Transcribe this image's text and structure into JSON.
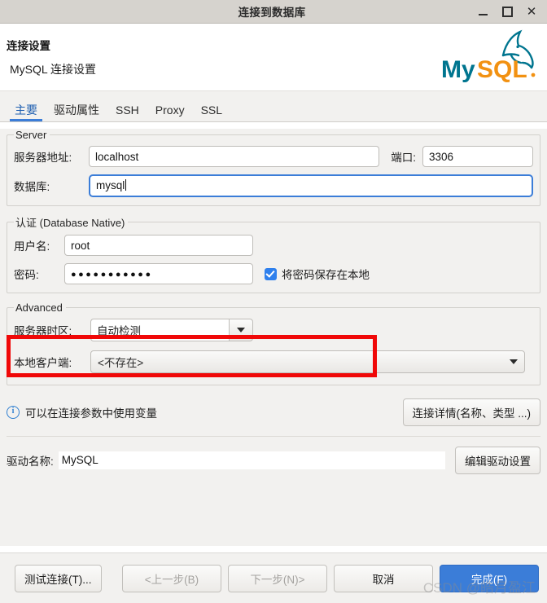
{
  "window": {
    "title": "连接到数据库",
    "minimize_label": "−",
    "maximize_label": "□",
    "close_label": "✕"
  },
  "header": {
    "title": "连接设置",
    "subtitle": "MySQL 连接设置",
    "logo_my": "My",
    "logo_sql": "SQL",
    "logo_reg": "®"
  },
  "tabs": [
    {
      "label": "主要",
      "active": true
    },
    {
      "label": "驱动属性",
      "active": false
    },
    {
      "label": "SSH",
      "active": false
    },
    {
      "label": "Proxy",
      "active": false
    },
    {
      "label": "SSL",
      "active": false
    }
  ],
  "server_group": {
    "legend": "Server",
    "host_label": "服务器地址:",
    "host_value": "localhost",
    "port_label": "端口:",
    "port_value": "3306",
    "database_label": "数据库:",
    "database_value": "mysql"
  },
  "auth_group": {
    "legend": "认证 (Database Native)",
    "username_label": "用户名:",
    "username_value": "root",
    "password_label": "密码:",
    "password_value": "●●●●●●●●●●●",
    "save_password_label": "将密码保存在本地",
    "save_password_checked": true
  },
  "advanced_group": {
    "legend": "Advanced",
    "timezone_label": "服务器时区:",
    "timezone_value": "自动检测",
    "local_client_label": "本地客户端:",
    "local_client_value": "<不存在>"
  },
  "info": {
    "text": "可以在连接参数中使用变量",
    "icon": "i",
    "details_button": "连接详情(名称、类型 ...)"
  },
  "driver": {
    "label": "驱动名称:",
    "value": "MySQL",
    "edit_button": "编辑驱动设置"
  },
  "footer": {
    "test_connection": "测试连接(T)...",
    "back": "<上一步(B)",
    "next": "下一步(N)>",
    "cancel": "取消",
    "finish": "完成(F)"
  },
  "watermark": "CSDN @皓月盈江",
  "colors": {
    "accent_blue": "#3b7dd8",
    "checkbox_blue": "#2f80ed",
    "highlight_red": "#f00808",
    "mysql_teal": "#00758f",
    "mysql_orange": "#f29111",
    "titlebar_bg": "#d6d3ce",
    "panel_bg": "#f2f1ef"
  }
}
